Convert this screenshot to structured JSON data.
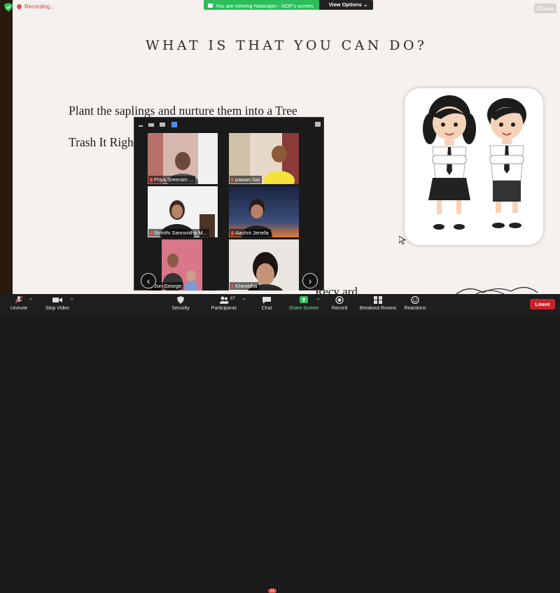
{
  "topbar": {
    "recording_label": "Recording...",
    "viewing_banner": "You are viewing Natarajan - NOF's screen",
    "view_options": "View Options ⌄",
    "view_button": "View"
  },
  "slide": {
    "title": "WHAT IS THAT YOU CAN DO?",
    "line1": "Plant the saplings and nurture them into a Tree",
    "line2": "Trash It Righ",
    "line3": "Recy  ard"
  },
  "gallery": {
    "participants": [
      {
        "name": "Priya Sreeram ..."
      },
      {
        "name": "pawan Sai"
      },
      {
        "name": "Smrithi Sannvritha M..."
      },
      {
        "name": "Aashni Jenefa"
      },
      {
        "name": "Jon George"
      },
      {
        "name": "Khenisha"
      }
    ],
    "prev": "‹",
    "next": "›"
  },
  "toolbar": {
    "unmute": "Unmute",
    "stop_video": "Stop Video",
    "security": "Security",
    "participants": "Participants",
    "participants_count": "87",
    "chat": "Chat",
    "chat_badge": "11",
    "share_screen": "Share Screen",
    "record": "Record",
    "breakout_rooms": "Breakout Rooms",
    "reactions": "Reactions",
    "leave": "Leave"
  },
  "colors": {
    "share_green": "#2dbd5a",
    "leave_red": "#c8232c",
    "slide_bg": "#f4f1ef"
  }
}
